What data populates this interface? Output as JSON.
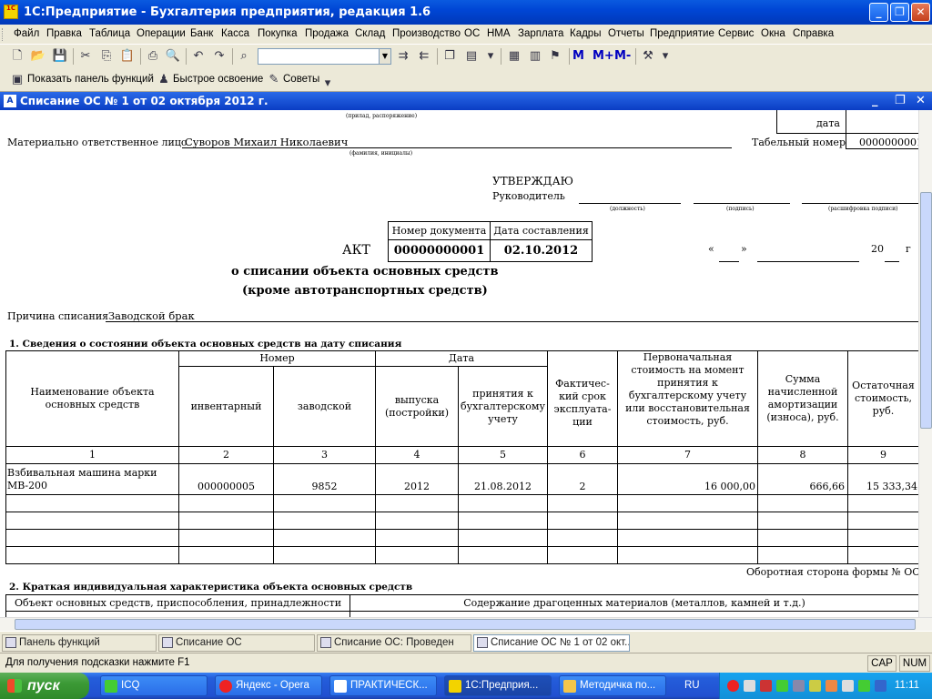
{
  "window": {
    "title": "1С:Предприятие - Бухгалтерия предприятия, редакция 1.6",
    "icon_text": "1C"
  },
  "menu": [
    "Файл",
    "Правка",
    "Таблица",
    "Операции",
    "Банк",
    "Касса",
    "Покупка",
    "Продажа",
    "Склад",
    "Производство",
    "ОС",
    "НМА",
    "Зарплата",
    "Кадры",
    "Отчеты",
    "Предприятие",
    "Сервис",
    "Окна",
    "Справка"
  ],
  "toolbar": {
    "search_value": "",
    "m_buttons": [
      "M",
      "M+",
      "M-"
    ]
  },
  "toolbar2": {
    "panel": "Показать панель функций",
    "quick": "Быстрое освоение",
    "tips": "Советы"
  },
  "doc_window": {
    "title": "Списание ОС № 1 от 02 октября 2012 г."
  },
  "form": {
    "top_caption": "(прилад, распоряжение)",
    "date_label": "дата",
    "mol_label": "Материально ответственное лицо",
    "mol_value": "Суворов Михаил Николаевич",
    "mol_caption": "(фамилия, инициалы)",
    "tab_label": "Табельный номер",
    "tab_value": "0000000001",
    "approve": "УТВЕРЖДАЮ",
    "head": "Руководитель",
    "cap_position": "(должность)",
    "cap_sign": "(подпись)",
    "cap_decode": "(расшифровка подписи)",
    "docnum_label": "Номер документа",
    "docdate_label": "Дата составления",
    "docnum_value": "00000000001",
    "docdate_value": "02.10.2012",
    "act": "АКТ",
    "quote_open": "«",
    "quote_close": "»",
    "year_prefix": "20",
    "year_suffix": "г",
    "subtitle1": "о списании объекта основных средств",
    "subtitle2": "(кроме автотранспортных средств)",
    "reason_label": "Причина списания",
    "reason_value": "Заводской брак",
    "section1": "1. Сведения о состоянии объекта основных средств на дату списания",
    "section2": "2. Краткая индивидуальная характеристика объекта основных средств",
    "back_side": "Оборотная сторона формы № ОС"
  },
  "table1": {
    "h_name": "Наименование объекта основных средств",
    "h_number": "Номер",
    "h_date": "Дата",
    "h_inv": "инвентарный",
    "h_fact": "заводской",
    "h_release": "выпуска (постройки)",
    "h_accept": "принятия к бухгалтерскому учету",
    "h_term": "Фактичес-кий срок эксплуата-ции",
    "h_initial": "Первоначальная стоимость на момент принятия к бухгалтерскому учету или восстановительная стоимость, руб.",
    "h_amort": "Сумма начисленной амортизации (износа), руб.",
    "h_rest": "Остаточная стоимость, руб.",
    "nums": [
      "1",
      "2",
      "3",
      "4",
      "5",
      "6",
      "7",
      "8",
      "9"
    ],
    "row": {
      "name": "Взбивальная машина марки МВ-200",
      "inv": "000000005",
      "fact": "9852",
      "release": "2012",
      "accept": "21.08.2012",
      "term": "2",
      "initial": "16 000,00",
      "amort": "666,66",
      "rest": "15 333,34"
    }
  },
  "table2": {
    "h_object": "Объект основных средств, приспособления, принадлежности",
    "h_content": "Содержание драгоценных материалов (металлов, камней и т.д.)"
  },
  "tabs": [
    "Панель функций",
    "Списание ОС",
    "Списание ОС: Проведен",
    "Списание ОС № 1 от 02 окт..."
  ],
  "status": {
    "hint": "Для получения подсказки нажмите F1",
    "cap": "CAP",
    "num": "NUM"
  },
  "taskbar": {
    "start": "пуск",
    "tasks": [
      "ICQ",
      "Яндекс - Opera",
      "ПРАКТИЧЕСК...",
      "1С:Предприя...",
      "Методичка по..."
    ],
    "lang": "RU",
    "clock": "11:11"
  }
}
